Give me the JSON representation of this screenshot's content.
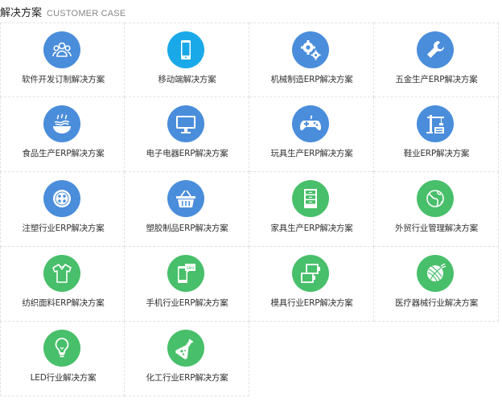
{
  "header": {
    "title": "解决方案",
    "subtitle": "CUSTOMER CASE"
  },
  "colors": {
    "blue": "#4a8ddb",
    "light_blue": "#1aa9e8",
    "green": "#48bf6a"
  },
  "items": [
    {
      "label": "软件开发订制解决方案",
      "icon": "team-icon"
    },
    {
      "label": "移动端解决方案",
      "icon": "smartphone-icon"
    },
    {
      "label": "机械制造ERP解决方案",
      "icon": "gears-icon"
    },
    {
      "label": "五金生产ERP解决方案",
      "icon": "wrench-icon"
    },
    {
      "label": "食品生产ERP解决方案",
      "icon": "noodle-bowl-icon"
    },
    {
      "label": "电子电器ERP解决方案",
      "icon": "monitor-icon"
    },
    {
      "label": "玩具生产ERP解决方案",
      "icon": "gamepad-icon"
    },
    {
      "label": "鞋业ERP解决方案",
      "icon": "crane-icon"
    },
    {
      "label": "注塑行业ERP解决方案",
      "icon": "button-icon"
    },
    {
      "label": "塑胶制品ERP解决方案",
      "icon": "basket-icon"
    },
    {
      "label": "家具生产ERP解决方案",
      "icon": "cabinet-icon"
    },
    {
      "label": "外贸行业管理解决方案",
      "icon": "globe-icon"
    },
    {
      "label": "纺织面料ERP解决方案",
      "icon": "tshirt-icon"
    },
    {
      "label": "手机行业ERP解决方案",
      "icon": "sms-phone-icon"
    },
    {
      "label": "模具行业ERP解决方案",
      "icon": "molds-icon"
    },
    {
      "label": "医疗器械行业解决方案",
      "icon": "yarn-ball-icon"
    },
    {
      "label": "LED行业解决方案",
      "icon": "light-bulb-icon"
    },
    {
      "label": "化工行业ERP解决方案",
      "icon": "flask-icon"
    }
  ]
}
